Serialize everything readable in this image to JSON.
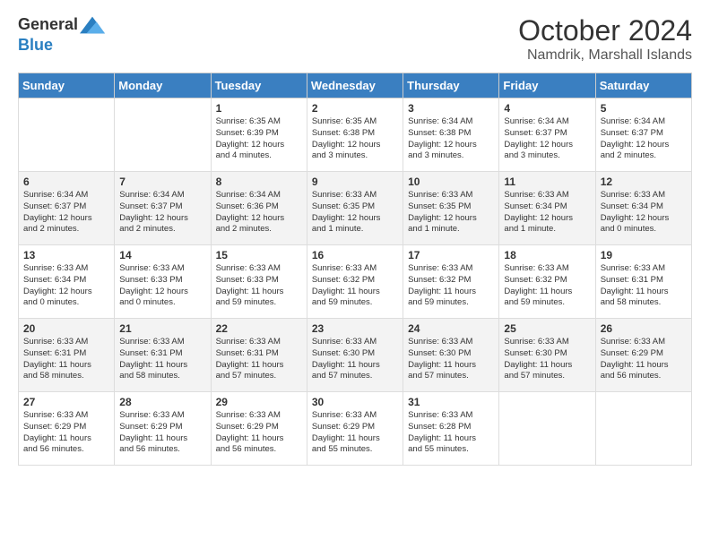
{
  "logo": {
    "line1": "General",
    "line2": "Blue"
  },
  "header": {
    "month": "October 2024",
    "location": "Namdrik, Marshall Islands"
  },
  "days_of_week": [
    "Sunday",
    "Monday",
    "Tuesday",
    "Wednesday",
    "Thursday",
    "Friday",
    "Saturday"
  ],
  "weeks": [
    [
      {
        "day": "",
        "content": ""
      },
      {
        "day": "",
        "content": ""
      },
      {
        "day": "1",
        "content": "Sunrise: 6:35 AM\nSunset: 6:39 PM\nDaylight: 12 hours\nand 4 minutes."
      },
      {
        "day": "2",
        "content": "Sunrise: 6:35 AM\nSunset: 6:38 PM\nDaylight: 12 hours\nand 3 minutes."
      },
      {
        "day": "3",
        "content": "Sunrise: 6:34 AM\nSunset: 6:38 PM\nDaylight: 12 hours\nand 3 minutes."
      },
      {
        "day": "4",
        "content": "Sunrise: 6:34 AM\nSunset: 6:37 PM\nDaylight: 12 hours\nand 3 minutes."
      },
      {
        "day": "5",
        "content": "Sunrise: 6:34 AM\nSunset: 6:37 PM\nDaylight: 12 hours\nand 2 minutes."
      }
    ],
    [
      {
        "day": "6",
        "content": "Sunrise: 6:34 AM\nSunset: 6:37 PM\nDaylight: 12 hours\nand 2 minutes."
      },
      {
        "day": "7",
        "content": "Sunrise: 6:34 AM\nSunset: 6:37 PM\nDaylight: 12 hours\nand 2 minutes."
      },
      {
        "day": "8",
        "content": "Sunrise: 6:34 AM\nSunset: 6:36 PM\nDaylight: 12 hours\nand 2 minutes."
      },
      {
        "day": "9",
        "content": "Sunrise: 6:33 AM\nSunset: 6:35 PM\nDaylight: 12 hours\nand 1 minute."
      },
      {
        "day": "10",
        "content": "Sunrise: 6:33 AM\nSunset: 6:35 PM\nDaylight: 12 hours\nand 1 minute."
      },
      {
        "day": "11",
        "content": "Sunrise: 6:33 AM\nSunset: 6:34 PM\nDaylight: 12 hours\nand 1 minute."
      },
      {
        "day": "12",
        "content": "Sunrise: 6:33 AM\nSunset: 6:34 PM\nDaylight: 12 hours\nand 0 minutes."
      }
    ],
    [
      {
        "day": "13",
        "content": "Sunrise: 6:33 AM\nSunset: 6:34 PM\nDaylight: 12 hours\nand 0 minutes."
      },
      {
        "day": "14",
        "content": "Sunrise: 6:33 AM\nSunset: 6:33 PM\nDaylight: 12 hours\nand 0 minutes."
      },
      {
        "day": "15",
        "content": "Sunrise: 6:33 AM\nSunset: 6:33 PM\nDaylight: 11 hours\nand 59 minutes."
      },
      {
        "day": "16",
        "content": "Sunrise: 6:33 AM\nSunset: 6:32 PM\nDaylight: 11 hours\nand 59 minutes."
      },
      {
        "day": "17",
        "content": "Sunrise: 6:33 AM\nSunset: 6:32 PM\nDaylight: 11 hours\nand 59 minutes."
      },
      {
        "day": "18",
        "content": "Sunrise: 6:33 AM\nSunset: 6:32 PM\nDaylight: 11 hours\nand 59 minutes."
      },
      {
        "day": "19",
        "content": "Sunrise: 6:33 AM\nSunset: 6:31 PM\nDaylight: 11 hours\nand 58 minutes."
      }
    ],
    [
      {
        "day": "20",
        "content": "Sunrise: 6:33 AM\nSunset: 6:31 PM\nDaylight: 11 hours\nand 58 minutes."
      },
      {
        "day": "21",
        "content": "Sunrise: 6:33 AM\nSunset: 6:31 PM\nDaylight: 11 hours\nand 58 minutes."
      },
      {
        "day": "22",
        "content": "Sunrise: 6:33 AM\nSunset: 6:31 PM\nDaylight: 11 hours\nand 57 minutes."
      },
      {
        "day": "23",
        "content": "Sunrise: 6:33 AM\nSunset: 6:30 PM\nDaylight: 11 hours\nand 57 minutes."
      },
      {
        "day": "24",
        "content": "Sunrise: 6:33 AM\nSunset: 6:30 PM\nDaylight: 11 hours\nand 57 minutes."
      },
      {
        "day": "25",
        "content": "Sunrise: 6:33 AM\nSunset: 6:30 PM\nDaylight: 11 hours\nand 57 minutes."
      },
      {
        "day": "26",
        "content": "Sunrise: 6:33 AM\nSunset: 6:29 PM\nDaylight: 11 hours\nand 56 minutes."
      }
    ],
    [
      {
        "day": "27",
        "content": "Sunrise: 6:33 AM\nSunset: 6:29 PM\nDaylight: 11 hours\nand 56 minutes."
      },
      {
        "day": "28",
        "content": "Sunrise: 6:33 AM\nSunset: 6:29 PM\nDaylight: 11 hours\nand 56 minutes."
      },
      {
        "day": "29",
        "content": "Sunrise: 6:33 AM\nSunset: 6:29 PM\nDaylight: 11 hours\nand 56 minutes."
      },
      {
        "day": "30",
        "content": "Sunrise: 6:33 AM\nSunset: 6:29 PM\nDaylight: 11 hours\nand 55 minutes."
      },
      {
        "day": "31",
        "content": "Sunrise: 6:33 AM\nSunset: 6:28 PM\nDaylight: 11 hours\nand 55 minutes."
      },
      {
        "day": "",
        "content": ""
      },
      {
        "day": "",
        "content": ""
      }
    ]
  ]
}
